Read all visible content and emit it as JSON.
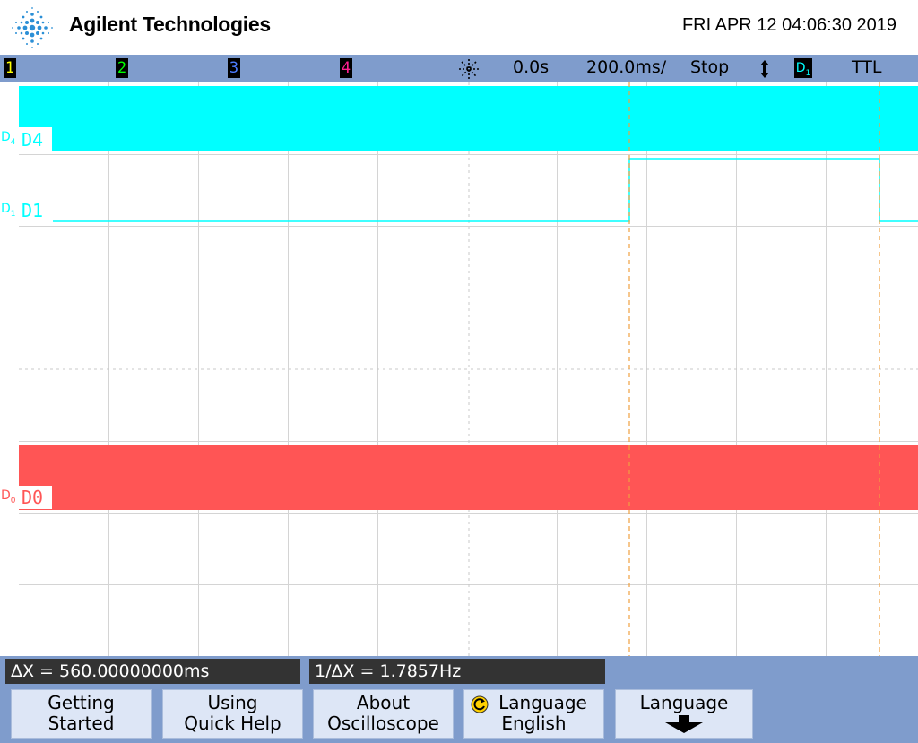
{
  "header": {
    "brand": "Agilent Technologies",
    "datetime": "FRI APR 12 04:06:30 2019"
  },
  "statusbar": {
    "channels": [
      {
        "label": "1",
        "color": "#ffff00"
      },
      {
        "label": "2",
        "color": "#00ff00"
      },
      {
        "label": "3",
        "color": "#4d7dff"
      },
      {
        "label": "4",
        "color": "#ff2090"
      }
    ],
    "trigger_icon": "trigger-asterisk-icon",
    "delay": "0.0s",
    "timebase": "200.0ms/",
    "run_state": "Stop",
    "trigger_slope_icon": "updown-arrow-icon",
    "trigger_source": "D",
    "trigger_source_sub": "1",
    "logic_level": "TTL"
  },
  "channel_labels": {
    "d4": {
      "prefix": "D",
      "sub": "4",
      "name": "D4"
    },
    "d1": {
      "prefix": "D",
      "sub": "1",
      "name": "D1"
    },
    "d0": {
      "prefix": "D",
      "sub": "0",
      "name": "D0"
    }
  },
  "colors": {
    "d4": "#00ffff",
    "d1": "#00ffff",
    "d0": "#ff5555",
    "cursor": "#f0a040",
    "grid": "#d4d4d4",
    "statusbar": "#7f9ccc"
  },
  "measurements": {
    "delta_x": "ΔX = 560.00000000ms",
    "inv_delta_x": "1/ΔX = 1.7857Hz"
  },
  "softkeys": [
    {
      "line1": "Getting",
      "line2": "Started"
    },
    {
      "line1": "Using",
      "line2": "Quick Help"
    },
    {
      "line1": "About",
      "line2": "Oscilloscope"
    },
    {
      "line1": "Language",
      "line2": "English",
      "icon": "rotate-icon"
    },
    {
      "line1": "Language",
      "icon": "down-arrow-icon"
    }
  ]
}
